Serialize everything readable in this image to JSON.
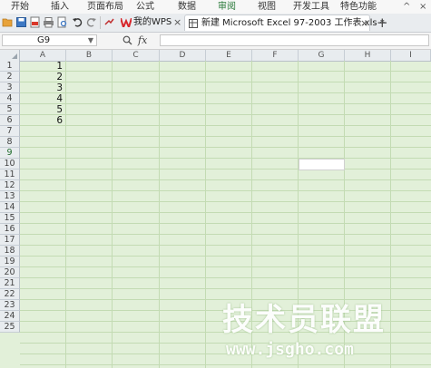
{
  "ribbon": {
    "tabs": [
      {
        "label": "开始",
        "active": false
      },
      {
        "label": "插入",
        "active": false
      },
      {
        "label": "页面布局",
        "active": false
      },
      {
        "label": "公式",
        "active": false
      },
      {
        "label": "数据",
        "active": false
      },
      {
        "label": "审阅",
        "active": true
      },
      {
        "label": "视图",
        "active": false
      },
      {
        "label": "开发工具",
        "active": false
      },
      {
        "label": "特色功能",
        "active": false
      }
    ]
  },
  "window_controls": {
    "up_arrow": "^",
    "close": "×"
  },
  "doc_tabs": {
    "wps": {
      "label": "我的WPS",
      "close": "×"
    },
    "excel": {
      "label": "新建 Microsoft Excel 97-2003 工作表.xls *",
      "close": "×"
    },
    "add": "+"
  },
  "formula_bar": {
    "name_box": "G9",
    "fx": "fx",
    "formula": ""
  },
  "sheet": {
    "columns": [
      "A",
      "B",
      "C",
      "D",
      "E",
      "F",
      "G",
      "H",
      "I"
    ],
    "rows": [
      "1",
      "2",
      "3",
      "4",
      "5",
      "6",
      "7",
      "8",
      "9",
      "10",
      "11",
      "12",
      "13",
      "14",
      "15",
      "16",
      "17",
      "18",
      "19",
      "20",
      "21",
      "22",
      "23",
      "24",
      "25"
    ],
    "selected_row": "9",
    "column_a_values": [
      "1",
      "2",
      "3",
      "4",
      "5",
      "6"
    ]
  },
  "colors": {
    "grid_bg": "#e2f0d9",
    "accent": "#2a7a3a"
  },
  "watermark": {
    "title": "技术员联盟",
    "url": "www.jsgho.com"
  }
}
